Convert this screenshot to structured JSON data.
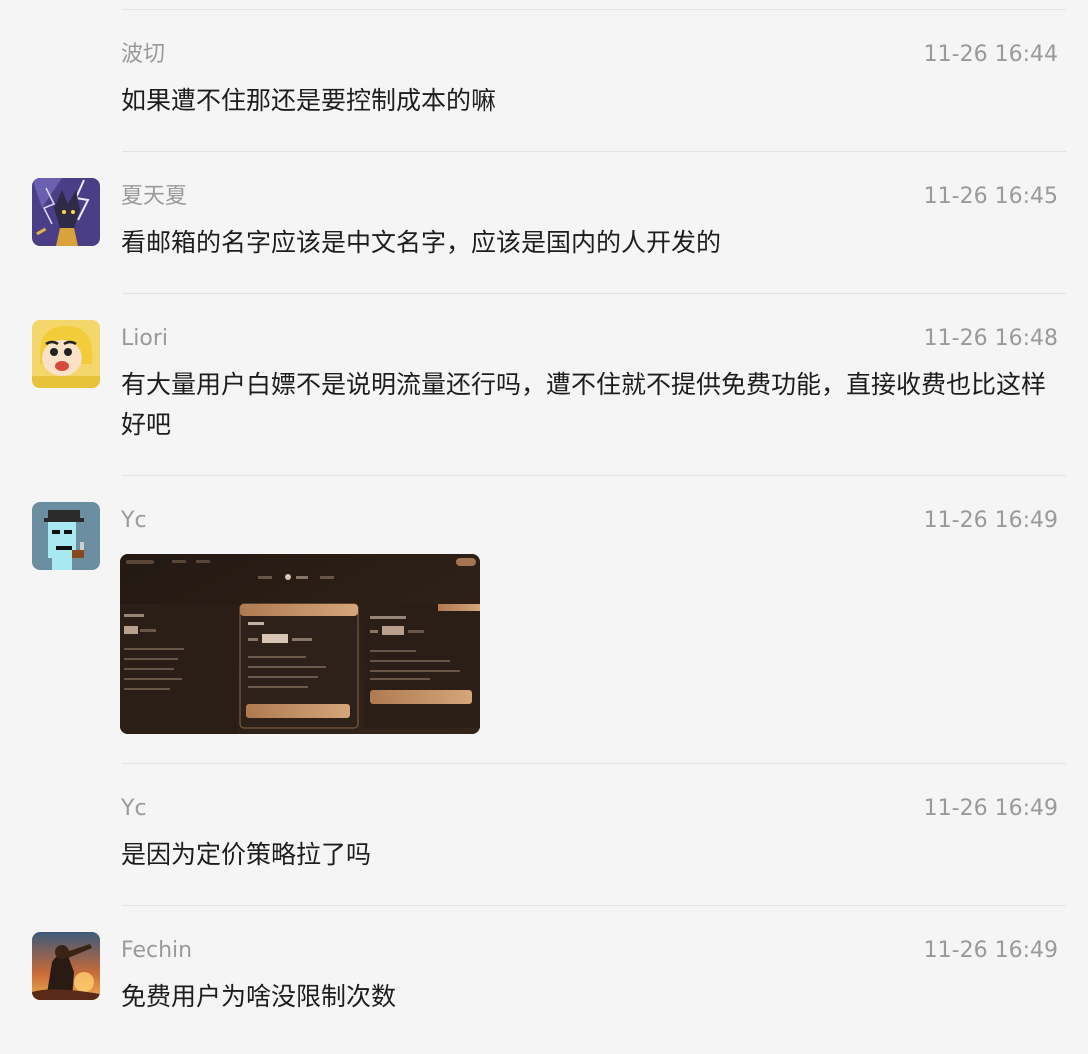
{
  "messages": [
    {
      "name": "波切",
      "time": "11-26 16:44",
      "text": "如果遭不住那还是要控制成本的嘛",
      "avatar": "none"
    },
    {
      "name": "夏天夏",
      "time": "11-26 16:45",
      "text": "看邮箱的名字应该是中文名字，应该是国内的人开发的",
      "avatar": "wolf-lightning-avatar"
    },
    {
      "name": "Liori",
      "time": "11-26 16:48",
      "text": "有大量用户白嫖不是说明流量还行吗，遭不住就不提供免费功能，直接收费也比这样好吧",
      "avatar": "crayon-shin-chan-avatar"
    },
    {
      "name": "Yc",
      "time": "11-26 16:49",
      "text": "",
      "avatar": "pixel-punk-avatar",
      "attachment": "pricing-plans-screenshot"
    },
    {
      "name": "Yc",
      "time": "11-26 16:49",
      "text": "是因为定价策略拉了吗",
      "avatar": "none"
    },
    {
      "name": "Fechin",
      "time": "11-26 16:49",
      "text": "免费用户为啥没限制次数",
      "avatar": "sunset-figure-avatar"
    }
  ],
  "colors": {
    "background": "#f5f5f5",
    "divider": "#e3e3e3",
    "meta_text": "#9a9a9a",
    "body_text": "#1d1d1d",
    "attachment_bg": "#2b1f17",
    "attachment_accent": "#c08a5b"
  }
}
